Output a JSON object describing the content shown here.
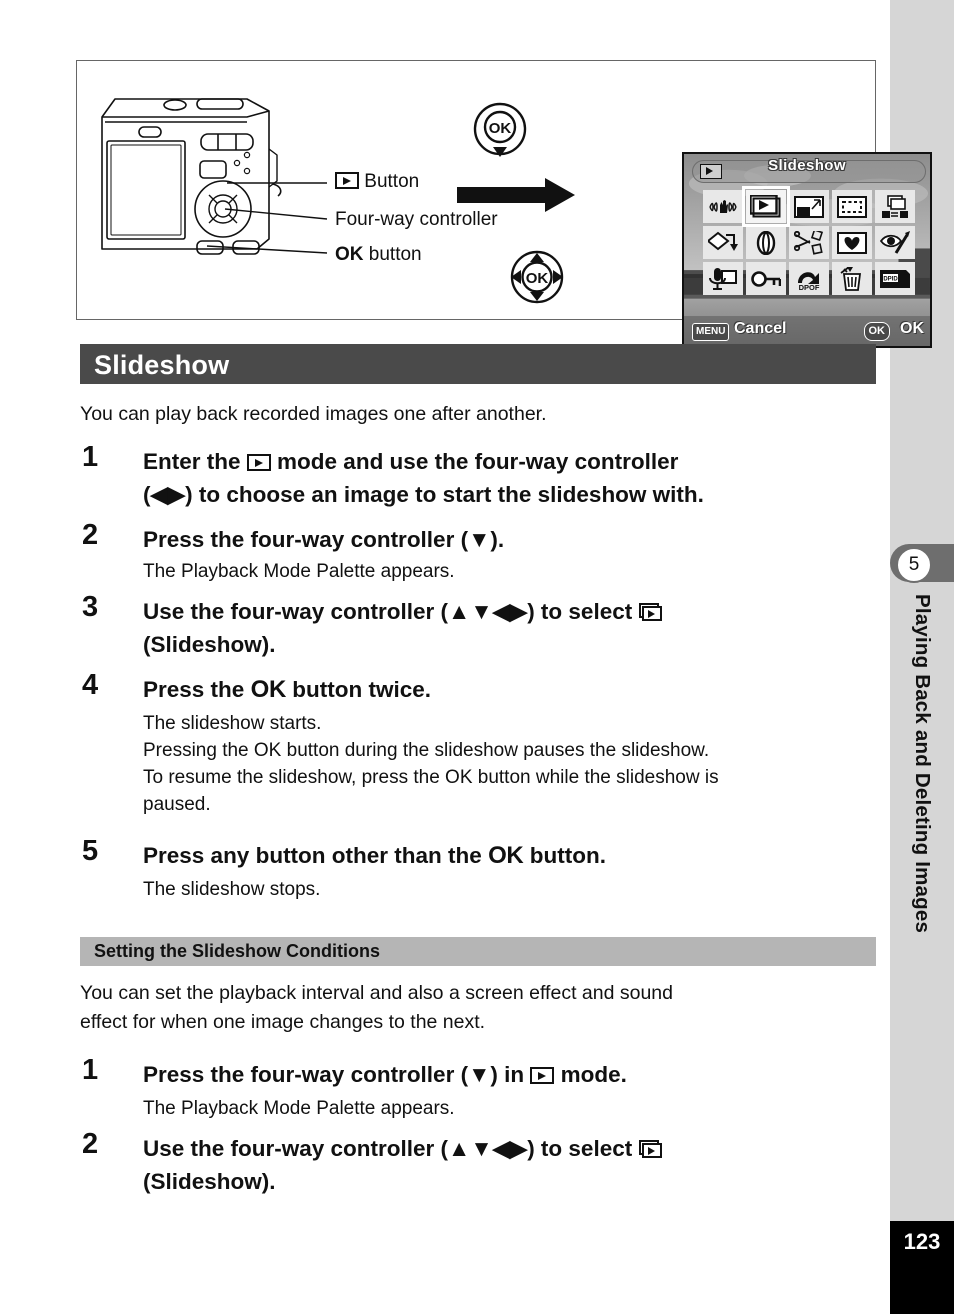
{
  "page": {
    "number": "123",
    "chapter_number": "5",
    "chapter_title": "Playing Back and Deleting Images"
  },
  "illustration": {
    "labels": {
      "playback_button": "Button",
      "four_way_controller": "Four-way controller",
      "ok_button_bold": "OK",
      "ok_button_rest": "button"
    },
    "icons": {
      "playback": "playback-icon",
      "ok_down": "four-way-controller-down-icon",
      "ok_all": "four-way-controller-all-icon",
      "flow_arrow": "right-arrow-icon"
    },
    "lcd": {
      "mode_icon": "playback-icon",
      "title": "Slideshow",
      "menu_key": "MENU",
      "cancel_label": "Cancel",
      "ok_key": "OK",
      "ok_label": "OK",
      "palette_rows": [
        [
          {
            "name": "shake-reduction-icon",
            "selected": false
          },
          {
            "name": "slideshow-icon",
            "selected": true
          },
          {
            "name": "resize-icon",
            "selected": false
          },
          {
            "name": "cropping-icon",
            "selected": false
          },
          {
            "name": "image-copy-icon",
            "selected": false
          }
        ],
        [
          {
            "name": "image-rotation-icon",
            "selected": false
          },
          {
            "name": "digital-filter-icon",
            "selected": false
          },
          {
            "name": "movie-edit-icon",
            "selected": false
          },
          {
            "name": "frame-composite-icon",
            "selected": false
          },
          {
            "name": "red-eye-compensation-icon",
            "selected": false
          }
        ],
        [
          {
            "name": "voice-memo-icon",
            "selected": false
          },
          {
            "name": "protect-icon",
            "selected": false
          },
          {
            "name": "dpof-icon",
            "selected": false
          },
          {
            "name": "delete-icon",
            "selected": false
          },
          {
            "name": "start-up-screen-icon",
            "selected": false
          }
        ]
      ]
    }
  },
  "section1": {
    "heading": "Slideshow",
    "intro": "You can play back recorded images one after another.",
    "steps": [
      {
        "num": "1",
        "line1_a": "Enter the",
        "line1_b": "mode and use the four-way controller",
        "line2": "(◀▶) to choose an image to start the slideshow with.",
        "body": []
      },
      {
        "num": "2",
        "title": "Press the four-way controller (▼).",
        "body": [
          "The Playback Mode Palette appears."
        ]
      },
      {
        "num": "3",
        "line1": "Use the four-way controller (▲▼◀▶) to select",
        "line2": "(Slideshow).",
        "body": []
      },
      {
        "num": "4",
        "title_a": "Press the",
        "title_ok": "OK",
        "title_b": "button twice.",
        "body": [
          "The slideshow starts.",
          "Pressing the OK button during the slideshow pauses the slideshow.",
          "To resume the slideshow, press the OK button while the slideshow is",
          "paused."
        ]
      },
      {
        "num": "5",
        "title_a": "Press any button other than the",
        "title_ok": "OK",
        "title_b": "button.",
        "body": [
          "The slideshow stops."
        ]
      }
    ]
  },
  "section2": {
    "heading": "Setting the Slideshow Conditions",
    "intro_line1": "You can set the playback interval and also a screen effect and sound",
    "intro_line2": "effect for when one image changes to the next.",
    "steps": [
      {
        "num": "1",
        "title_a": "Press the four-way controller (▼) in",
        "title_b": "mode.",
        "body": [
          "The Playback Mode Palette appears."
        ]
      },
      {
        "num": "2",
        "line1": "Use the four-way controller (▲▼◀▶) to select",
        "line2": "(Slideshow).",
        "body": []
      }
    ]
  },
  "colors": {
    "h1_bg": "#4a4a4a",
    "h2_bg": "#b5b5b5",
    "rail_bg": "#d6d6d6",
    "tab_bg": "#6e6e6e",
    "page_tab_bg": "#000000"
  }
}
